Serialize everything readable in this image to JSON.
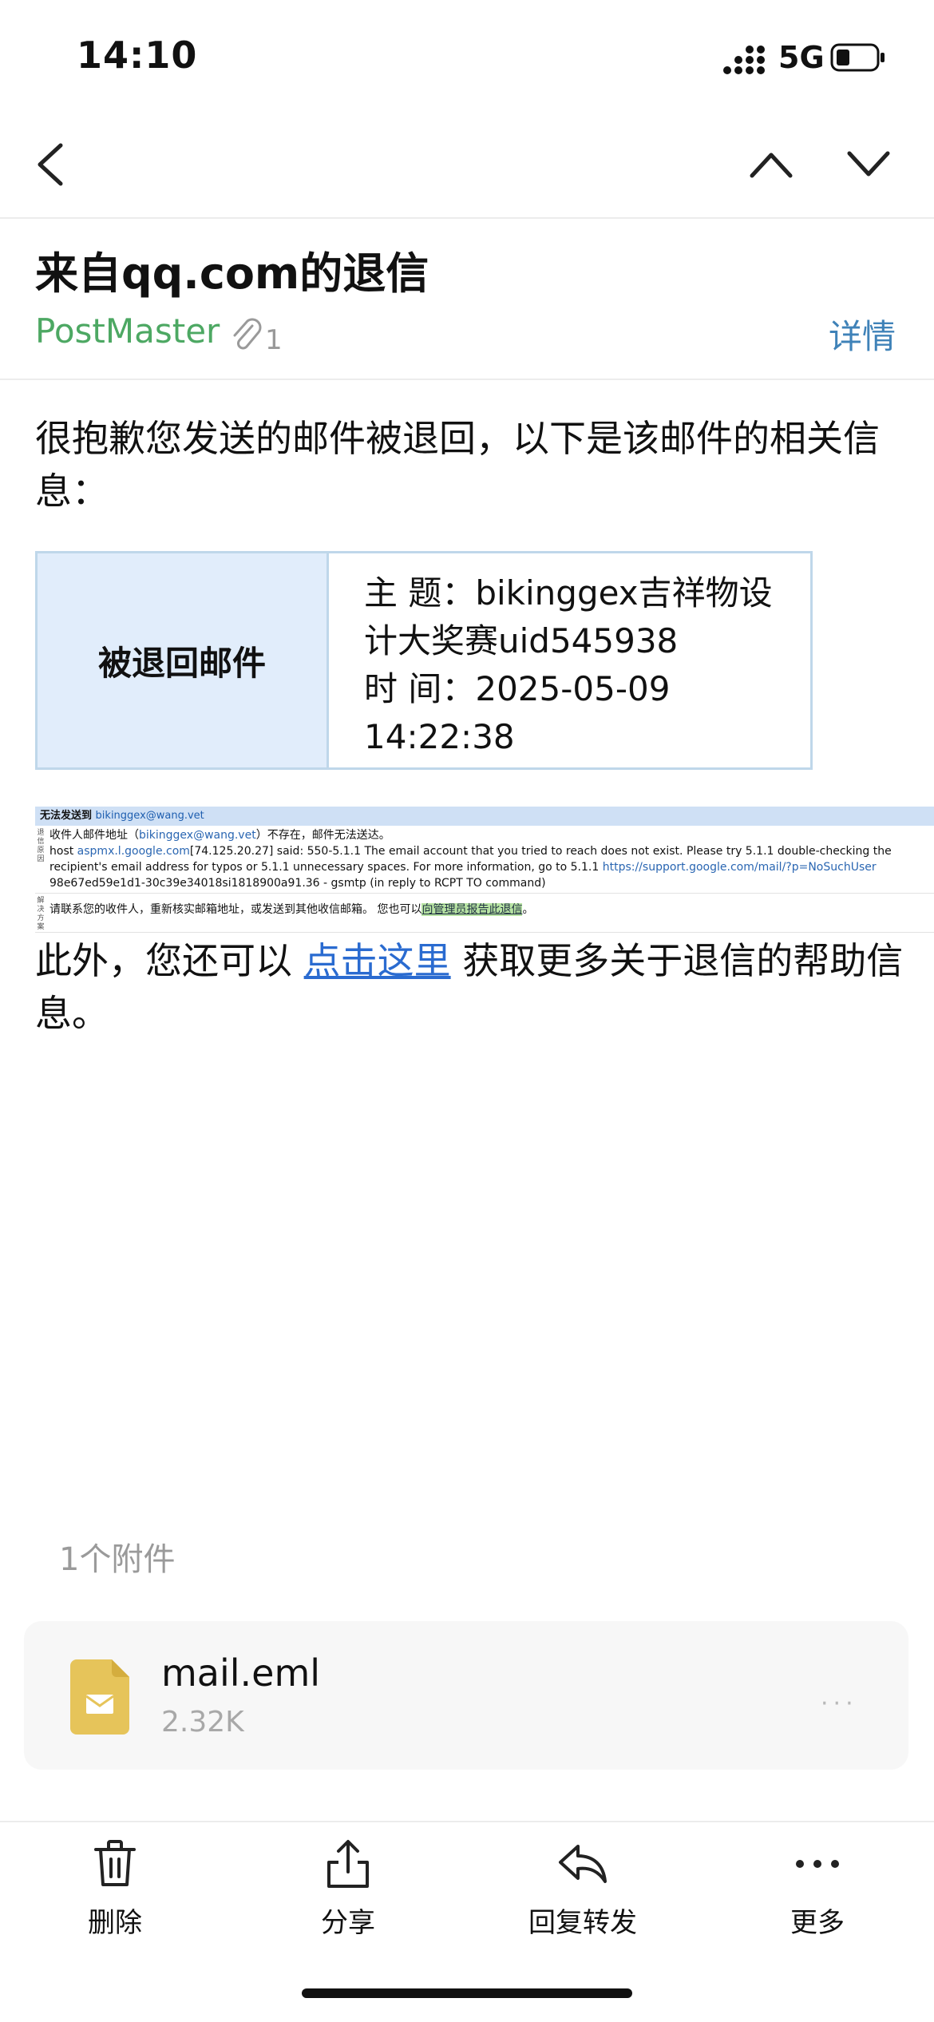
{
  "status": {
    "time": "14:10",
    "network": "5G"
  },
  "mail": {
    "subject": "来自qq.com的退信",
    "sender": "PostMaster",
    "attachment_count": "1",
    "details": "详情",
    "intro": "很抱歉您发送的邮件被退回，以下是该邮件的相关信息：",
    "bounce_table": {
      "header": "被退回邮件",
      "subject_line": "主 题：bikinggex吉祥物设计大奖赛uid545938",
      "time_line": "时 间：2025-05-09 14:22:38"
    },
    "report": {
      "bar_prefix": "无法发送到",
      "bar_address": "bikinggex@wang.vet",
      "reason_label": "退信原因",
      "line1_a": "收件人邮件地址（",
      "line1_link": "bikinggex@wang.vet",
      "line1_b": "）不存在，邮件无法送达。",
      "line2_a": "host ",
      "line2_link": "aspmx.l.google.com",
      "line2_b": "[74.125.20.27] said: 550-5.1.1 The email account that you tried to reach does not exist. Please try 5.1.1 double-checking the recipient's email address for typos or 5.1.1 unnecessary spaces. For more information, go to 5.1.1 ",
      "line2_url": "https://support.google.com/mail/?p=NoSuchUser",
      "line2_c": " 98e67ed59e1d1-30c39e34018si1818900a91.36 - gsmtp (in reply to RCPT TO command)",
      "solution_label": "解决方案",
      "solution_a": "请联系您的收件人，重新核实邮箱地址，或发送到其他收信邮箱。 您也可以",
      "solution_link": "向管理员报告此退信",
      "solution_b": "。"
    },
    "outro_a": "此外，您还可以 ",
    "outro_link": "点击这里",
    "outro_b": " 获取更多关于退信的帮助信息。"
  },
  "attachments": {
    "label": "1个附件",
    "items": [
      {
        "name": "mail.eml",
        "size": "2.32K",
        "more": "···"
      }
    ]
  },
  "toolbar": {
    "delete": "删除",
    "share": "分享",
    "reply_forward": "回复转发",
    "more": "更多"
  },
  "colors": {
    "sender": "#4da863",
    "link": "#2a6bd0",
    "table_header_bg": "#e1edfb",
    "file_icon": "#e6c45a"
  }
}
